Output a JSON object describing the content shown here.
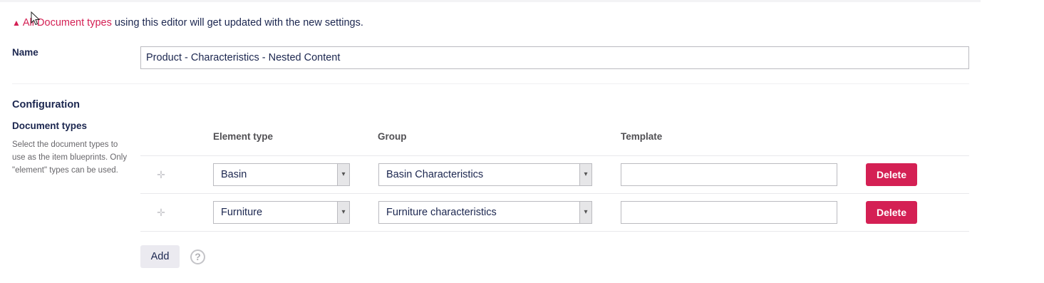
{
  "warning": {
    "icon": "warning-triangle-icon",
    "prefix": "All",
    "highlight": "Document types",
    "rest": " using this editor will get updated with the new settings."
  },
  "name": {
    "label": "Name",
    "value": "Product - Characteristics - Nested Content"
  },
  "configuration": {
    "heading": "Configuration",
    "document_types": {
      "label": "Document types",
      "description": "Select the document types to use as the item blueprints. Only \"element\" types can be used."
    },
    "columns": {
      "element_type": "Element type",
      "group": "Group",
      "template": "Template"
    },
    "rows": [
      {
        "element_type": "Basin",
        "group": "Basin Characteristics",
        "template": "",
        "delete_label": "Delete"
      },
      {
        "element_type": "Furniture",
        "group": "Furniture characteristics",
        "template": "",
        "delete_label": "Delete"
      }
    ],
    "add_label": "Add"
  },
  "colors": {
    "accent": "#d42054",
    "text": "#1b264f",
    "muted": "#68676b"
  }
}
